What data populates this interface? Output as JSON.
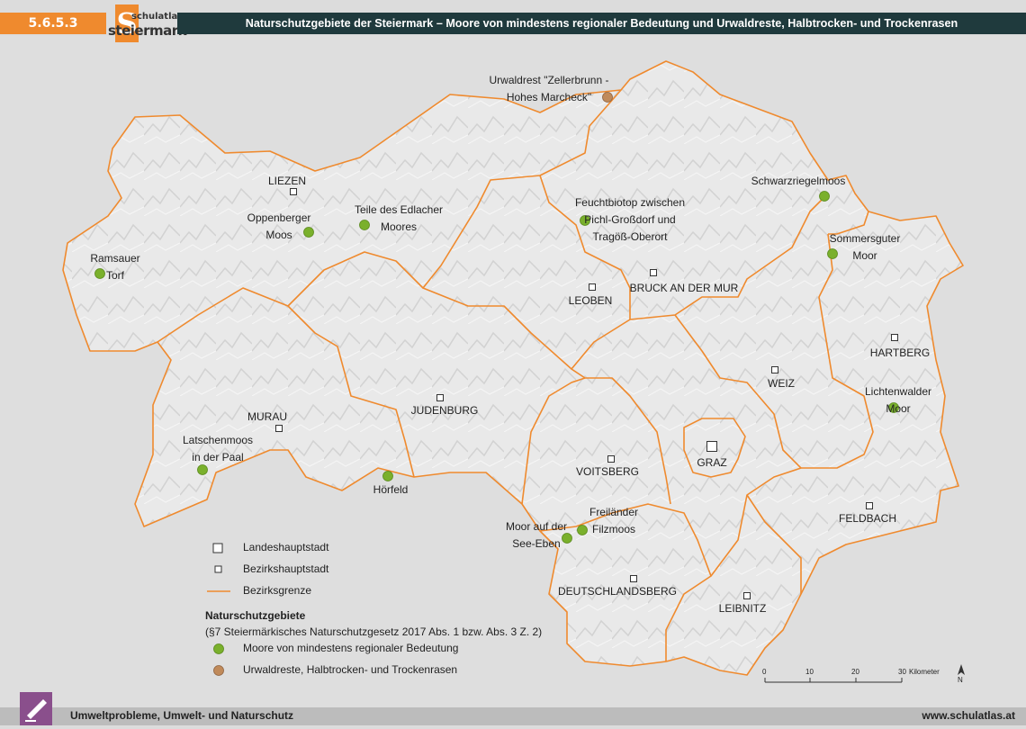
{
  "header": {
    "section": "5.6.5.3",
    "logo_top": "schulatlas",
    "logo_main": "steiermark",
    "logo_letter": "S",
    "title": "Naturschutzgebiete der Steiermark – Moore von mindestens regionaler Bedeutung und Urwaldreste, Halbtrocken- und Trockenrasen"
  },
  "map": {
    "colors": {
      "border": "#ef8a2e",
      "moor": "#7ab02c",
      "urwald": "#c08a5a",
      "relief": "#e8e8e8"
    },
    "cities": [
      {
        "name": "LIEZEN",
        "type": "bezirk"
      },
      {
        "name": "LEOBEN",
        "type": "bezirk"
      },
      {
        "name": "BRUCK AN DER MUR",
        "type": "bezirk"
      },
      {
        "name": "HARTBERG",
        "type": "bezirk"
      },
      {
        "name": "WEIZ",
        "type": "bezirk"
      },
      {
        "name": "JUDENBURG",
        "type": "bezirk"
      },
      {
        "name": "MURAU",
        "type": "bezirk"
      },
      {
        "name": "VOITSBERG",
        "type": "bezirk"
      },
      {
        "name": "GRAZ",
        "type": "landes"
      },
      {
        "name": "FELDBACH",
        "type": "bezirk"
      },
      {
        "name": "DEUTSCHLANDSBERG",
        "type": "bezirk"
      },
      {
        "name": "LEIBNITZ",
        "type": "bezirk"
      }
    ],
    "sites": [
      {
        "line1": "Urwaldrest \"Zellerbrunn -",
        "line2": "Hohes Marcheck\"",
        "type": "urwald"
      },
      {
        "line1": "Schwarzriegelmoos",
        "line2": "",
        "type": "moor"
      },
      {
        "line1": "Feuchtbiotop zwischen",
        "line2": "Pichl-Großdorf und",
        "line3": "Tragöß-Oberort",
        "type": "moor"
      },
      {
        "line1": "Oppenberger",
        "line2": "Moos",
        "type": "moor"
      },
      {
        "line1": "Teile des Edlacher",
        "line2": "Moores",
        "type": "moor"
      },
      {
        "line1": "Ramsauer",
        "line2": "Torf",
        "type": "moor"
      },
      {
        "line1": "Sommersguter",
        "line2": "Moor",
        "type": "moor"
      },
      {
        "line1": "Lichtenwalder",
        "line2": "Moor",
        "type": "moor"
      },
      {
        "line1": "Latschenmoos",
        "line2": "in der Paal",
        "type": "moor"
      },
      {
        "line1": "Hörfeld",
        "line2": "",
        "type": "moor"
      },
      {
        "line1": "Freiländer",
        "line2": "Filzmoos",
        "type": "moor"
      },
      {
        "line1": "Moor auf der",
        "line2": "See-Eben",
        "type": "moor"
      }
    ]
  },
  "legend": {
    "landeshauptstadt": "Landeshauptstadt",
    "bezirkshauptstadt": "Bezirkshauptstadt",
    "bezirksgrenze": "Bezirksgrenze",
    "title": "Naturschutzgebiete",
    "subtitle": "(§7 Steiermärkisches Naturschutzgesetz 2017 Abs. 1 bzw. Abs. 3 Z. 2)",
    "moor": "Moore von mindestens regionaler Bedeutung",
    "urwald": "Urwaldreste, Halbtrocken- und Trockenrasen"
  },
  "scale": {
    "ticks": [
      "0",
      "10",
      "20",
      "30"
    ],
    "unit": "Kilometer",
    "north": "N"
  },
  "footer": {
    "left": "Umweltprobleme, Umwelt- und Naturschutz",
    "right": "www.schulatlas.at"
  }
}
